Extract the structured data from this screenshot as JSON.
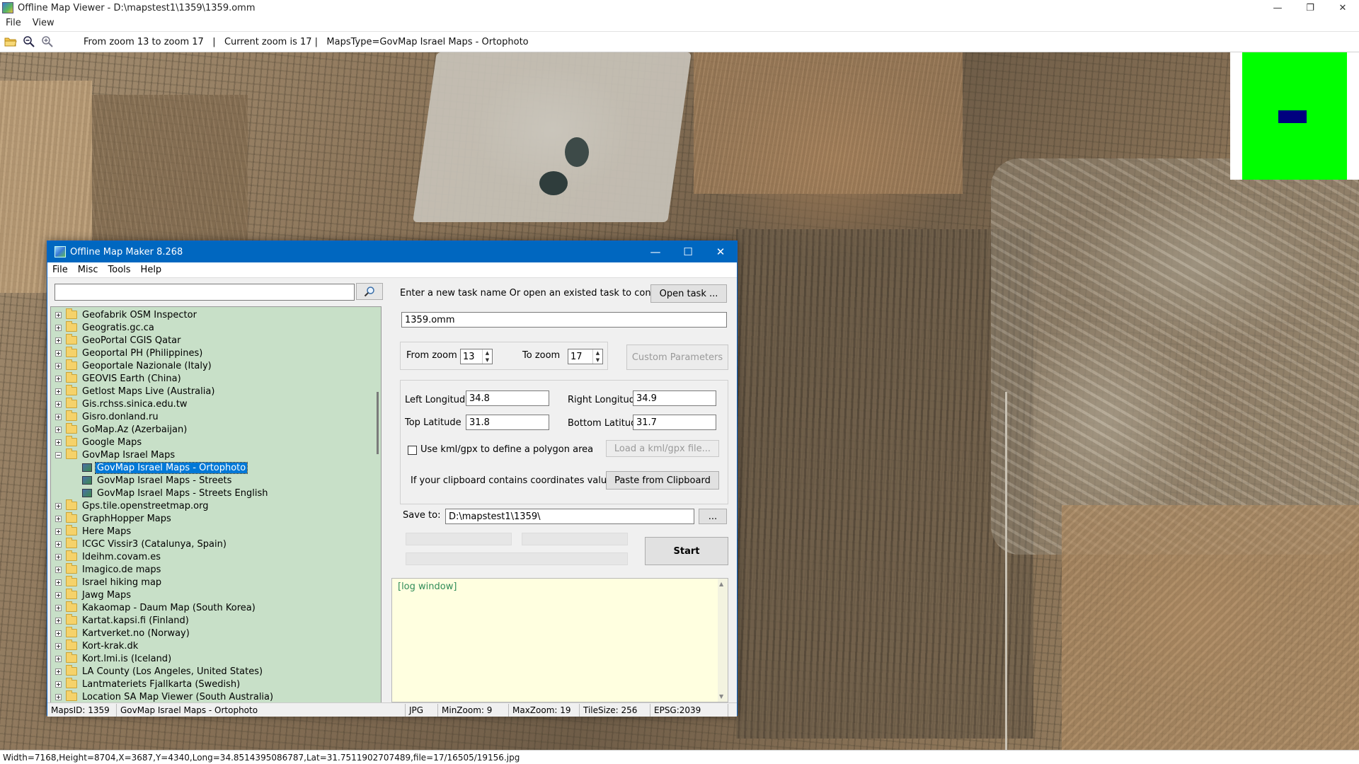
{
  "viewer": {
    "title": "Offline Map Viewer - D:\\mapstest1\\1359\\1359.omm",
    "menu": [
      "File",
      "View"
    ],
    "toolbar_status": "From zoom 13 to zoom 17   |   Current zoom is 17 |   MapsType=GovMap Israel Maps - Ortophoto",
    "statusbar": "Width=7168,Height=8704,X=3687,Y=4340,Long=34.8514395086787,Lat=31.7511902707489,file=17/16505/19156.jpg",
    "icons": [
      "open-folder-icon",
      "zoom-out-icon",
      "zoom-in-icon"
    ]
  },
  "maker": {
    "title": "Offline Map Maker 8.268",
    "menu": [
      "File",
      "Misc",
      "Tools",
      "Help"
    ],
    "search_value": "",
    "tree": [
      {
        "label": "Geofabrik OSM Inspector",
        "type": "folder",
        "expanded": false
      },
      {
        "label": "Geogratis.gc.ca",
        "type": "folder",
        "expanded": false
      },
      {
        "label": "GeoPortal CGIS Qatar",
        "type": "folder",
        "expanded": false
      },
      {
        "label": "Geoportal PH (Philippines)",
        "type": "folder",
        "expanded": false
      },
      {
        "label": "Geoportale Nazionale (Italy)",
        "type": "folder",
        "expanded": false
      },
      {
        "label": "GEOVIS Earth (China)",
        "type": "folder",
        "expanded": false
      },
      {
        "label": "Getlost Maps Live (Australia)",
        "type": "folder",
        "expanded": false
      },
      {
        "label": "Gis.rchss.sinica.edu.tw",
        "type": "folder",
        "expanded": false
      },
      {
        "label": "Gisro.donland.ru",
        "type": "folder",
        "expanded": false
      },
      {
        "label": "GoMap.Az (Azerbaijan)",
        "type": "folder",
        "expanded": false
      },
      {
        "label": "Google Maps",
        "type": "folder",
        "expanded": false
      },
      {
        "label": "GovMap Israel Maps",
        "type": "folder",
        "expanded": true
      },
      {
        "label": "GovMap Israel Maps - Ortophoto",
        "type": "map",
        "selected": true
      },
      {
        "label": "GovMap Israel Maps - Streets",
        "type": "map"
      },
      {
        "label": "GovMap Israel Maps - Streets English",
        "type": "map"
      },
      {
        "label": "Gps.tile.openstreetmap.org",
        "type": "folder",
        "expanded": false
      },
      {
        "label": "GraphHopper Maps",
        "type": "folder",
        "expanded": false
      },
      {
        "label": "Here Maps",
        "type": "folder",
        "expanded": false
      },
      {
        "label": "ICGC Vissir3 (Catalunya, Spain)",
        "type": "folder",
        "expanded": false
      },
      {
        "label": "Ideihm.covam.es",
        "type": "folder",
        "expanded": false
      },
      {
        "label": "Imagico.de maps",
        "type": "folder",
        "expanded": false
      },
      {
        "label": "Israel hiking map",
        "type": "folder",
        "expanded": false
      },
      {
        "label": "Jawg Maps",
        "type": "folder",
        "expanded": false
      },
      {
        "label": "Kakaomap - Daum Map (South Korea)",
        "type": "folder",
        "expanded": false
      },
      {
        "label": "Kartat.kapsi.fi (Finland)",
        "type": "folder",
        "expanded": false
      },
      {
        "label": "Kartverket.no (Norway)",
        "type": "folder",
        "expanded": false
      },
      {
        "label": "Kort-krak.dk",
        "type": "folder",
        "expanded": false
      },
      {
        "label": "Kort.lmi.is (Iceland)",
        "type": "folder",
        "expanded": false
      },
      {
        "label": "LA County (Los Angeles, United States)",
        "type": "folder",
        "expanded": false
      },
      {
        "label": "Lantmateriets Fjallkarta (Swedish)",
        "type": "folder",
        "expanded": false
      },
      {
        "label": "Location SA Map Viewer (South Australia)",
        "type": "folder",
        "expanded": false
      }
    ],
    "task_prompt": "Enter a new task name Or open an existed task to continue:",
    "open_task_label": "Open task ...",
    "task_name": "1359.omm",
    "from_zoom_label": "From zoom",
    "from_zoom_value": "13",
    "to_zoom_label": "To zoom",
    "to_zoom_value": "17",
    "custom_params_label": "Custom Parameters",
    "left_lon_label": "Left Longitude",
    "left_lon_value": "34.8",
    "right_lon_label": "Right Longitude",
    "right_lon_value": "34.9",
    "top_lat_label": "Top Latitude",
    "top_lat_value": "31.8",
    "bottom_lat_label": "Bottom Latitude",
    "bottom_lat_value": "31.7",
    "kml_label": "Use kml/gpx to define a polygon area",
    "load_kml_label": "Load a kml/gpx file...",
    "clipboard_label": "If your clipboard contains coordinates values:",
    "paste_label": "Paste from Clipboard",
    "save_label": "Save to:",
    "save_path": "D:\\mapstest1\\1359\\",
    "browse_label": "...",
    "start_label": "Start",
    "log_text": "[log window]",
    "status": {
      "maps_id": "MapsID: 1359",
      "maps_name": "GovMap Israel Maps - Ortophoto",
      "format": "JPG",
      "min_zoom": "MinZoom: 9",
      "max_zoom": "MaxZoom: 19",
      "tile_size": "TileSize: 256",
      "epsg": "EPSG:2039"
    },
    "icons": [
      "search-icon",
      "folder-icon",
      "map-layer-icon"
    ]
  },
  "colors": {
    "dialog_titlebar": "#0067c0",
    "tree_background": "#c8e0c8",
    "selection": "#0078d7",
    "log_background": "#ffffe0",
    "log_text": "#2e8b57",
    "minimap_area": "#00ff00",
    "minimap_view": "#00007f"
  }
}
